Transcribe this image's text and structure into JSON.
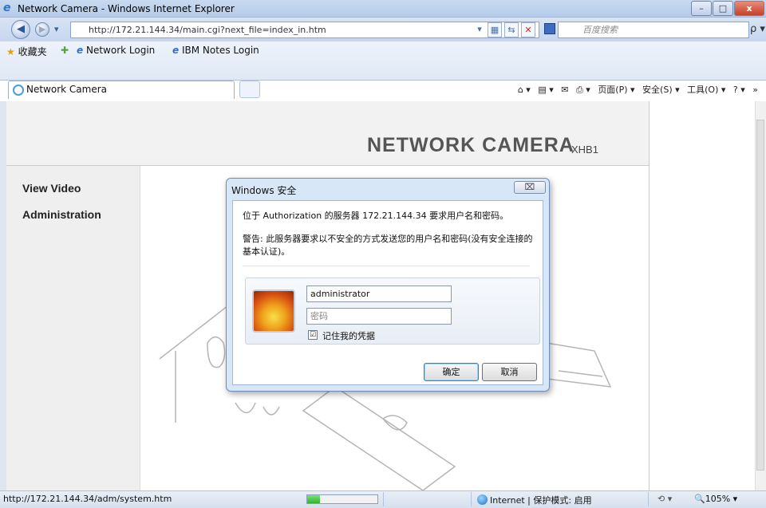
{
  "window": {
    "title": "Network Camera - Windows Internet Explorer",
    "minimize": "–",
    "maximize": "□",
    "close": "x"
  },
  "address_bar": {
    "back": "◀",
    "forward": "▶",
    "dropdown": "▾",
    "url": "http://172.21.144.34/main.cgi?next_file=index_in.htm",
    "search_placeholder": "百度搜索",
    "search_go": "ρ ▾"
  },
  "favorites_bar": {
    "favorites_label": "收藏夹",
    "links": [
      "Network Login",
      "IBM Notes Login"
    ]
  },
  "tab": {
    "label": "Network Camera"
  },
  "command_bar": {
    "items": [
      "⌂ ▾",
      "▤ ▾",
      "✉",
      "⎙ ▾",
      "页面(P) ▾",
      "安全(S) ▾",
      "工具(O) ▾",
      "? ▾",
      "»"
    ]
  },
  "page": {
    "header_title": "NETWORK CAMERA",
    "model": "XHB1",
    "nav": [
      "View Video",
      "Administration"
    ]
  },
  "dialog": {
    "title": "Windows 安全",
    "close": "⌧",
    "message": "位于 Authorization 的服务器 172.21.144.34 要求用户名和密码。",
    "warning": "警告: 此服务器要求以不安全的方式发送您的用户名和密码(没有安全连接的基本认证)。",
    "username_value": "administrator",
    "password_placeholder": "密码",
    "remember_label": "记住我的凭据",
    "remember_checked": "☑",
    "ok_label": "确定",
    "cancel_label": "取消"
  },
  "statusbar": {
    "url": "http://172.21.144.34/adm/system.htm",
    "progress": 0.18,
    "zone": "Internet | 保护模式: 启用",
    "zoom_icon": "⟲ ▾",
    "zoom": "🔍105%  ▾"
  }
}
